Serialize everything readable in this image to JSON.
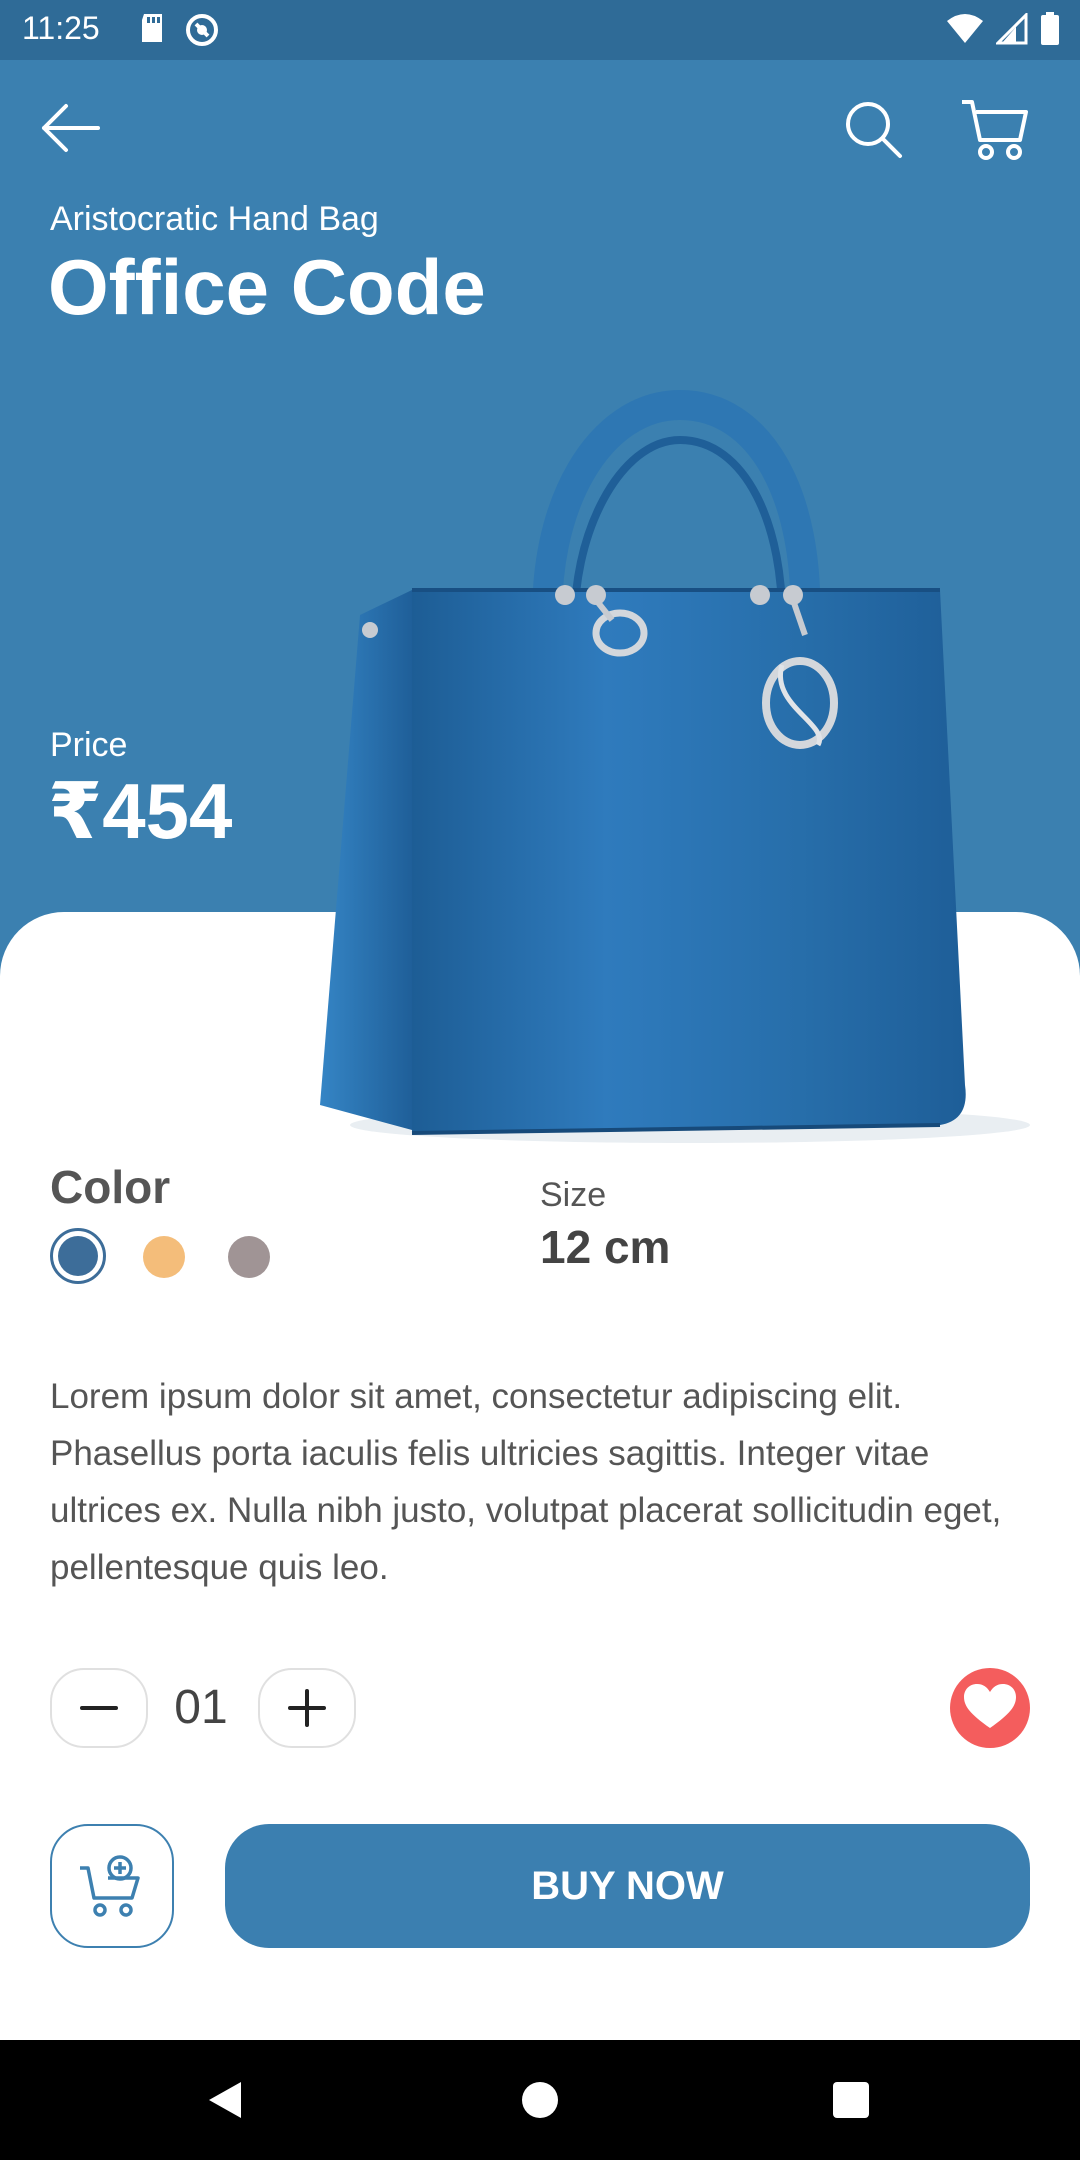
{
  "status_bar": {
    "time": "11:25",
    "icons": [
      "sd-card-icon",
      "data-saver-icon",
      "wifi-icon",
      "signal-icon",
      "battery-icon"
    ]
  },
  "header": {
    "back_icon": "arrow-left-icon",
    "search_icon": "search-icon",
    "cart_icon": "cart-icon"
  },
  "product": {
    "category": "Aristocratic Hand Bag",
    "name": "Office Code",
    "price_label": "Price",
    "price": "₹454",
    "color_label": "Color",
    "colors": [
      {
        "name": "blue",
        "hex": "#3d6d99",
        "selected": true
      },
      {
        "name": "orange",
        "hex": "#f4bd7a",
        "selected": false
      },
      {
        "name": "gray",
        "hex": "#a09495",
        "selected": false
      }
    ],
    "size_label": "Size",
    "size": "12 cm",
    "description": "Lorem ipsum dolor sit amet, consectetur adipiscing elit. Phasellus porta iaculis felis ultricies sagittis. Integer vitae ultrices ex. Nulla nibh justo, volutpat placerat sollicitudin eget, pellentesque quis leo."
  },
  "quantity": {
    "value": "01",
    "minus_icon": "minus-icon",
    "plus_icon": "plus-icon"
  },
  "actions": {
    "favorite_icon": "heart-icon",
    "add_to_cart_icon": "cart-add-icon",
    "buy_now": "BUY NOW"
  },
  "colors": {
    "primary": "#3b80b0",
    "status_bar": "#2f6b97",
    "favorite": "#f45d5d"
  },
  "nav_bar": {
    "buttons": [
      "nav-back-icon",
      "nav-home-icon",
      "nav-recents-icon"
    ]
  }
}
